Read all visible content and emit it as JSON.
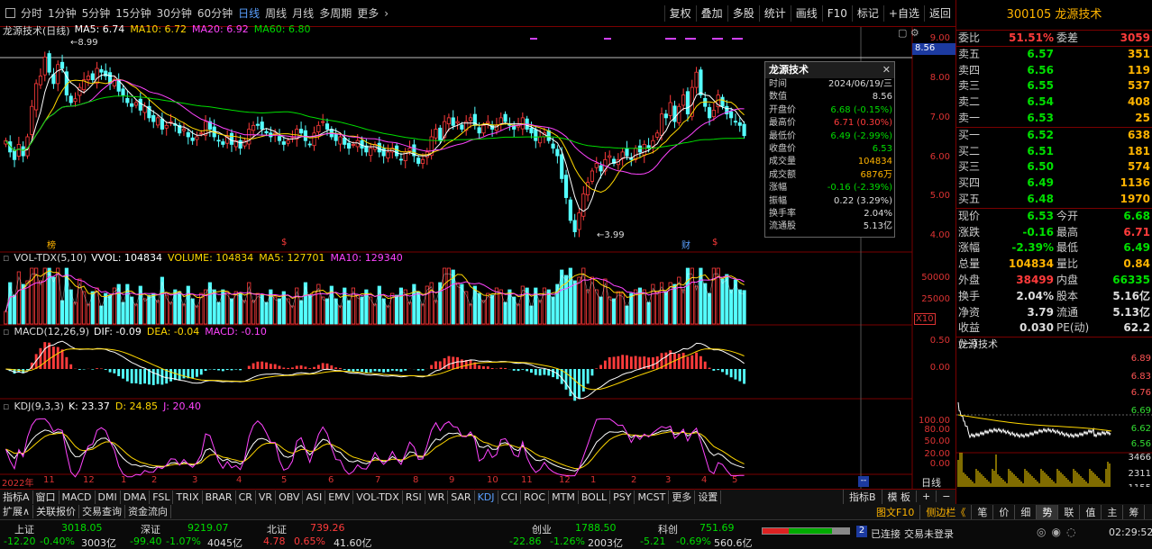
{
  "toolbar": {
    "periods": [
      "分时",
      "1分钟",
      "5分钟",
      "15分钟",
      "30分钟",
      "60分钟",
      "日线",
      "周线",
      "月线",
      "多周期",
      "更多"
    ],
    "active_period": "日线",
    "right_buttons": [
      "复权",
      "叠加",
      "多股",
      "统计",
      "画线",
      "F10",
      "标记",
      "+自选",
      "返回"
    ]
  },
  "kline": {
    "title": "龙源技术(日线)",
    "ma_labels": [
      {
        "text": "MA5: 6.74",
        "color": "#ffffff"
      },
      {
        "text": "MA10: 6.72",
        "color": "#ffd700"
      },
      {
        "text": "MA20: 6.92",
        "color": "#ff44ff"
      },
      {
        "text": "MA60: 6.80",
        "color": "#00dd00"
      }
    ],
    "high_mark": "8.99",
    "low_mark": "3.99",
    "current_price_tag": "8.56",
    "y_ticks": [
      "9.00",
      "8.00",
      "7.00",
      "6.00",
      "5.00",
      "4.00"
    ],
    "markers": [
      "榜",
      "$",
      "财",
      "$"
    ]
  },
  "popup": {
    "title": "龙源技术",
    "rows": [
      {
        "k": "时间",
        "v": "2024/06/19/三",
        "c": "#ddd"
      },
      {
        "k": "数值",
        "v": "8.56",
        "c": "#ddd"
      },
      {
        "k": "开盘价",
        "v": "6.68 (-0.15%)",
        "c": "#00dd00"
      },
      {
        "k": "最高价",
        "v": "6.71 (0.30%)",
        "c": "#ff3b3b"
      },
      {
        "k": "最低价",
        "v": "6.49 (-2.99%)",
        "c": "#00dd00"
      },
      {
        "k": "收盘价",
        "v": "6.53",
        "c": "#00dd00"
      },
      {
        "k": "成交量",
        "v": "104834",
        "c": "#ffb400"
      },
      {
        "k": "成交额",
        "v": "6876万",
        "c": "#ffb400"
      },
      {
        "k": "涨幅",
        "v": "-0.16 (-2.39%)",
        "c": "#00dd00"
      },
      {
        "k": "振幅",
        "v": "0.22 (3.29%)",
        "c": "#ddd"
      },
      {
        "k": "换手率",
        "v": "2.04%",
        "c": "#ddd"
      },
      {
        "k": "流通股",
        "v": "5.13亿",
        "c": "#ddd"
      }
    ]
  },
  "vol": {
    "title": "VOL-TDX(5,10)",
    "labels": [
      {
        "text": "VVOL: 104834",
        "color": "#ffffff"
      },
      {
        "text": "VOLUME: 104834",
        "color": "#ffd700"
      },
      {
        "text": "MA5: 127701",
        "color": "#ffd700"
      },
      {
        "text": "MA10: 129340",
        "color": "#ff44ff"
      }
    ],
    "y_ticks": [
      "50000",
      "25000"
    ],
    "unit": "X10"
  },
  "macd": {
    "title": "MACD(12,26,9)",
    "labels": [
      {
        "text": "DIF: -0.09",
        "color": "#ffffff"
      },
      {
        "text": "DEA: -0.04",
        "color": "#ffd700"
      },
      {
        "text": "MACD: -0.10",
        "color": "#ff44ff"
      }
    ],
    "y_ticks": [
      "0.50",
      "0.00"
    ]
  },
  "kdj": {
    "title": "KDJ(9,3,3)",
    "labels": [
      {
        "text": "K: 23.37",
        "color": "#ffffff"
      },
      {
        "text": "D: 24.85",
        "color": "#ffd700"
      },
      {
        "text": "J: 20.40",
        "color": "#ff44ff"
      }
    ],
    "y_ticks": [
      "100.00",
      "80.00",
      "50.00",
      "20.00",
      "0.00"
    ]
  },
  "date_axis": {
    "labels": [
      "2022年",
      "11",
      "12",
      "1",
      "2",
      "3",
      "4",
      "5",
      "6",
      "7",
      "8",
      "9",
      "10",
      "11",
      "12",
      "1",
      "2",
      "3",
      "4",
      "5",
      "6"
    ],
    "right_label": "日线"
  },
  "indicator_tabs": [
    "指标A",
    "窗口",
    "MACD",
    "DMI",
    "DMA",
    "FSL",
    "TRIX",
    "BRAR",
    "CR",
    "VR",
    "OBV",
    "ASI",
    "EMV",
    "VOL-TDX",
    "RSI",
    "WR",
    "SAR",
    "KDJ",
    "CCI",
    "ROC",
    "MTM",
    "BOLL",
    "PSY",
    "MCST",
    "更多",
    "设置"
  ],
  "active_indicator": "KDJ",
  "indicator_tabs_right": [
    "指标B",
    "模 板",
    "+",
    "−"
  ],
  "bottom_tabs": [
    "扩展∧",
    "关联报价",
    "交易查询",
    "资金流向"
  ],
  "right_panel": {
    "code_name": "300105 龙源技术",
    "weibi": {
      "k1": "委比",
      "v1": "51.51%",
      "k2": "委差",
      "v2": "3059"
    },
    "sells": [
      {
        "l": "卖五",
        "p": "6.57",
        "v": "351"
      },
      {
        "l": "卖四",
        "p": "6.56",
        "v": "119"
      },
      {
        "l": "卖三",
        "p": "6.55",
        "v": "537"
      },
      {
        "l": "卖二",
        "p": "6.54",
        "v": "408"
      },
      {
        "l": "卖一",
        "p": "6.53",
        "v": "25"
      }
    ],
    "buys": [
      {
        "l": "买一",
        "p": "6.52",
        "v": "638"
      },
      {
        "l": "买二",
        "p": "6.51",
        "v": "181"
      },
      {
        "l": "买三",
        "p": "6.50",
        "v": "574"
      },
      {
        "l": "买四",
        "p": "6.49",
        "v": "1136"
      },
      {
        "l": "买五",
        "p": "6.48",
        "v": "1970"
      }
    ],
    "stats": [
      {
        "k1": "现价",
        "v1": "6.53",
        "c1": "green",
        "k2": "今开",
        "v2": "6.68",
        "c2": "green"
      },
      {
        "k1": "涨跌",
        "v1": "-0.16",
        "c1": "green",
        "k2": "最高",
        "v2": "6.71",
        "c2": "red"
      },
      {
        "k1": "涨幅",
        "v1": "-2.39%",
        "c1": "green",
        "k2": "最低",
        "v2": "6.49",
        "c2": "green"
      },
      {
        "k1": "总量",
        "v1": "104834",
        "c1": "yel",
        "k2": "量比",
        "v2": "0.84",
        "c2": "yel"
      },
      {
        "k1": "外盘",
        "v1": "38499",
        "c1": "red",
        "k2": "内盘",
        "v2": "66335",
        "c2": "green"
      },
      {
        "k1": "换手",
        "v1": "2.04%",
        "c1": "wh",
        "k2": "股本",
        "v2": "5.16亿",
        "c2": "wh"
      },
      {
        "k1": "净资",
        "v1": "3.79",
        "c1": "wh",
        "k2": "流通",
        "v2": "5.13亿",
        "c2": "wh"
      },
      {
        "k1": "收益(一)",
        "v1": "0.030",
        "c1": "wh",
        "k2": "PE(动)",
        "v2": "62.2",
        "c2": "wh"
      }
    ],
    "mini_title": "龙源技术",
    "mini_ticks": [
      "6.89",
      "6.83",
      "6.76",
      "6.69",
      "6.62",
      "6.56",
      "3466",
      "2311",
      "1155"
    ],
    "tabs": [
      "图文F10",
      "侧边栏《",
      "笔",
      "价",
      "细",
      "势",
      "联",
      "值",
      "主",
      "筹"
    ]
  },
  "indexes": [
    {
      "name": "上证",
      "price": "3018.05",
      "chg": "-12.20",
      "pct": "-0.40%",
      "amt": "3003亿",
      "color": "#00dd00"
    },
    {
      "name": "深证",
      "price": "9219.07",
      "chg": "-99.40",
      "pct": "-1.07%",
      "amt": "4045亿",
      "color": "#00dd00"
    },
    {
      "name": "北证",
      "price": "739.26",
      "chg": "4.78",
      "pct": "0.65%",
      "amt": "41.60亿",
      "color": "#ff3b3b"
    },
    {
      "name": "创业",
      "price": "1788.50",
      "chg": "-22.86",
      "pct": "-1.26%",
      "amt": "2003亿",
      "color": "#00dd00"
    },
    {
      "name": "科创",
      "price": "751.69",
      "chg": "-5.21",
      "pct": "-0.69%",
      "amt": "560.6亿",
      "color": "#00dd00"
    }
  ],
  "status": {
    "conn": "已连接",
    "trade": "交易未登录",
    "time": "02:29:52"
  },
  "chart_data": {
    "type": "candlestick",
    "title": "龙源技术(日线)",
    "ylim": [
      3.8,
      9.2
    ],
    "closes": [
      6.4,
      6.1,
      5.9,
      6.3,
      6.0,
      6.5,
      7.3,
      7.9,
      8.1,
      8.6,
      8.2,
      7.9,
      8.4,
      8.3,
      7.6,
      7.4,
      7.5,
      7.8,
      8.0,
      8.1,
      8.0,
      8.3,
      8.2,
      8.1,
      7.9,
      8.0,
      7.7,
      7.6,
      7.4,
      7.3,
      7.4,
      7.2,
      7.3,
      7.0,
      6.9,
      7.0,
      6.7,
      6.8,
      6.9,
      6.8,
      6.6,
      6.7,
      6.5,
      6.4,
      6.5,
      6.6,
      6.9,
      6.7,
      6.5,
      6.4,
      6.3,
      6.5,
      6.3,
      6.4,
      6.2,
      6.4,
      6.7,
      6.8,
      6.8,
      6.7,
      6.6,
      6.5,
      6.6,
      6.4,
      6.3,
      6.4,
      6.5,
      6.7,
      6.6,
      6.4,
      6.3,
      6.6,
      6.8,
      6.9,
      6.7,
      6.5,
      6.4,
      6.5,
      6.3,
      6.2,
      6.3,
      6.4,
      6.2,
      6.1,
      6.2,
      6.3,
      6.1,
      6.0,
      6.1,
      6.2,
      6.0,
      5.9,
      6.1,
      6.2,
      6.0,
      5.8,
      5.9,
      6.1,
      6.5,
      6.7,
      6.4,
      6.9,
      7.0,
      6.8,
      6.9,
      6.7,
      6.9,
      7.0,
      6.8,
      6.6,
      6.8,
      6.9,
      6.7,
      6.8,
      7.0,
      6.9,
      6.8,
      6.7,
      6.8,
      7.0,
      6.7,
      6.6,
      6.4,
      6.5,
      6.6,
      6.4,
      6.2,
      6.0,
      5.4,
      4.9,
      4.3,
      4.0,
      4.5,
      5.0,
      5.3,
      5.6,
      5.8,
      5.6,
      5.9,
      6.0,
      5.8,
      5.9,
      6.1,
      6.0,
      5.9,
      6.2,
      6.1,
      6.3,
      6.2,
      6.4,
      6.6,
      7.1,
      7.0,
      7.4,
      6.9,
      7.3,
      7.6,
      7.1,
      7.8,
      8.2,
      7.6,
      7.3,
      7.0,
      7.2,
      7.6,
      7.3,
      7.1,
      7.0,
      6.9,
      6.8,
      6.53
    ],
    "markers": {
      "high": "8.99",
      "low": "3.99",
      "current": "8.56"
    }
  }
}
